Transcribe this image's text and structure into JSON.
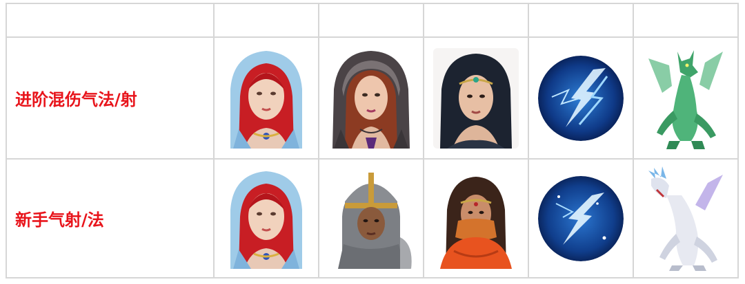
{
  "header": {
    "cells": [
      "",
      "",
      "",
      "",
      "",
      ""
    ]
  },
  "rows": [
    {
      "label": "进阶混伤气法/射",
      "images": [
        {
          "name": "blue-hooded-red-hair-hero-portrait",
          "kind": "portrait"
        },
        {
          "name": "dark-hooded-brunette-hero-portrait",
          "kind": "portrait"
        },
        {
          "name": "black-hair-tiara-hero-portrait",
          "kind": "portrait"
        },
        {
          "name": "lightning-skill-icon",
          "kind": "orb"
        },
        {
          "name": "green-dragon-image",
          "kind": "dragon"
        }
      ]
    },
    {
      "label": "新手气射/法",
      "images": [
        {
          "name": "blue-hooded-red-hair-hero-portrait",
          "kind": "portrait"
        },
        {
          "name": "chainmail-helmet-warrior-portrait",
          "kind": "portrait"
        },
        {
          "name": "red-veiled-woman-portrait",
          "kind": "portrait"
        },
        {
          "name": "ice-lightning-skill-icon",
          "kind": "orb"
        },
        {
          "name": "white-crystal-dragon-image",
          "kind": "dragon"
        }
      ]
    }
  ],
  "colors": {
    "label": "#e8141b",
    "grid": "#d6d6d6"
  }
}
